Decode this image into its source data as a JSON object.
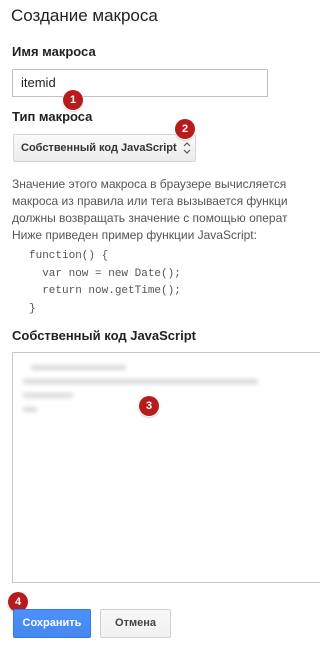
{
  "dialog": {
    "title": "Создание макроса"
  },
  "macro_name": {
    "label": "Имя макроса",
    "value": "itemid"
  },
  "macro_type": {
    "label": "Тип макроса",
    "selected": "Собственный код JavaScript"
  },
  "description": {
    "lines": [
      "Значение этого макроса в браузере вычисляется",
      "макроса из правила или тега вызывается функци",
      "должны возвращать значение с помощью операт",
      "Ниже приведен пример функции JavaScript:"
    ],
    "code": [
      "function() {",
      "  var now = new Date();",
      "  return now.getTime();",
      "}"
    ]
  },
  "custom_js": {
    "label": "Собственный код JavaScript"
  },
  "badges": [
    "1",
    "2",
    "3",
    "4"
  ],
  "buttons": {
    "save": "Сохранить",
    "cancel": "Отмена"
  },
  "colors": {
    "badge": "#b71c1c",
    "primary_button": "#4d90fe"
  }
}
